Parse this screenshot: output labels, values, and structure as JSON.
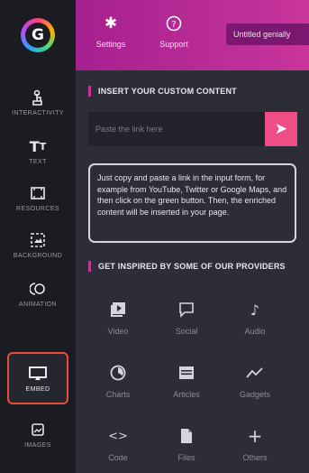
{
  "header": {
    "settings_label": "Settings",
    "support_label": "Support",
    "title": "Untitled genially"
  },
  "sidebar": {
    "items": [
      {
        "label": "Interactivity",
        "icon": "touch-icon"
      },
      {
        "label": "Text",
        "icon": "text-icon"
      },
      {
        "label": "Resources",
        "icon": "image-frame-icon"
      },
      {
        "label": "Background",
        "icon": "background-icon"
      },
      {
        "label": "Animation",
        "icon": "animation-icon"
      },
      {
        "label": "Embed",
        "icon": "monitor-icon"
      },
      {
        "label": "Images",
        "icon": "picture-icon"
      }
    ]
  },
  "main": {
    "insert_title": "INSERT YOUR CUSTOM CONTENT",
    "link_placeholder": "Paste the link here",
    "help_text": "Just copy and paste a link in the input form, for example from YouTube, Twitter or Google Maps, and then click on the green button. Then, the enriched content will be inserted in your page.",
    "providers_title": "GET INSPIRED BY SOME OF OUR PROVIDERS",
    "providers": [
      {
        "label": "Video",
        "icon": "video-icon"
      },
      {
        "label": "Social",
        "icon": "speech-bubble-icon"
      },
      {
        "label": "Audio",
        "icon": "music-note-icon"
      },
      {
        "label": "Charts",
        "icon": "chart-icon"
      },
      {
        "label": "Articles",
        "icon": "article-icon"
      },
      {
        "label": "Gadgets",
        "icon": "gadget-icon"
      },
      {
        "label": "Code",
        "icon": "code-icon"
      },
      {
        "label": "Files",
        "icon": "file-icon"
      },
      {
        "label": "Others",
        "icon": "plus-icon"
      }
    ]
  },
  "colors": {
    "accent": "#c4359c",
    "send_button": "#ef4d85",
    "active_outline": "#e94b3c"
  }
}
